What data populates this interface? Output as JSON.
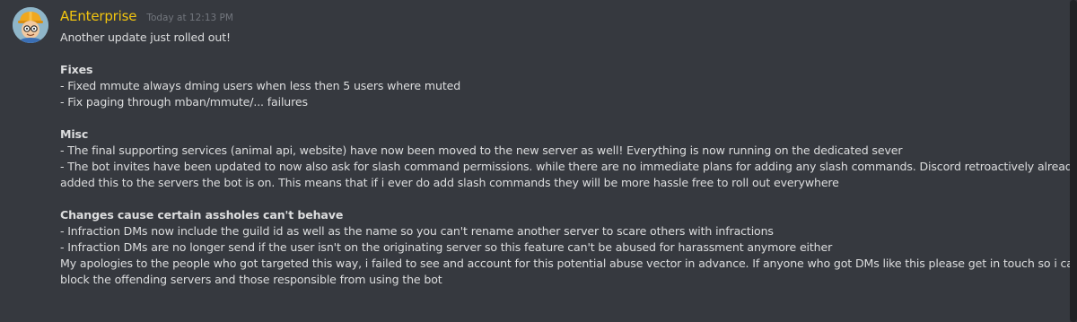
{
  "message": {
    "author": "AEnterprise",
    "timestamp": "Today at 12:13 PM",
    "intro": "Another update just rolled out!",
    "fixes": {
      "heading": "Fixes",
      "items": [
        "- Fixed mmute always dming users when less then 5 users where muted",
        "- Fix paging through mban/mmute/... failures"
      ]
    },
    "misc": {
      "heading": "Misc",
      "items": [
        "- The final supporting services (animal api, website) have now been moved to the new server as well! Everything is now running on the dedicated sever",
        "- The bot invites have been updated to now also ask for slash command permissions. while there are no immediate plans for adding any slash commands. Discord retroactively already",
        "added this to the servers the bot is on. This means that if i ever do add slash commands they will be more hassle free to roll out everywhere"
      ]
    },
    "changes": {
      "heading": "Changes cause certain assholes can't behave",
      "items": [
        "- Infraction DMs now include the guild id as well as the name so you can't rename another server to scare others with infractions",
        "- Infraction DMs are no longer send if the user isn't on the originating server so this feature can't be abused for harassment anymore either",
        "My apologies to the people who got targeted this way, i failed to see and account for this potential abuse vector in advance. If anyone who got DMs like this please get in touch so i can",
        "block the offending servers and those responsible from using the bot"
      ]
    }
  },
  "colors": {
    "background": "#36393f",
    "username": "#f1c40f",
    "text": "#dcddde",
    "timestamp": "#72767d"
  }
}
